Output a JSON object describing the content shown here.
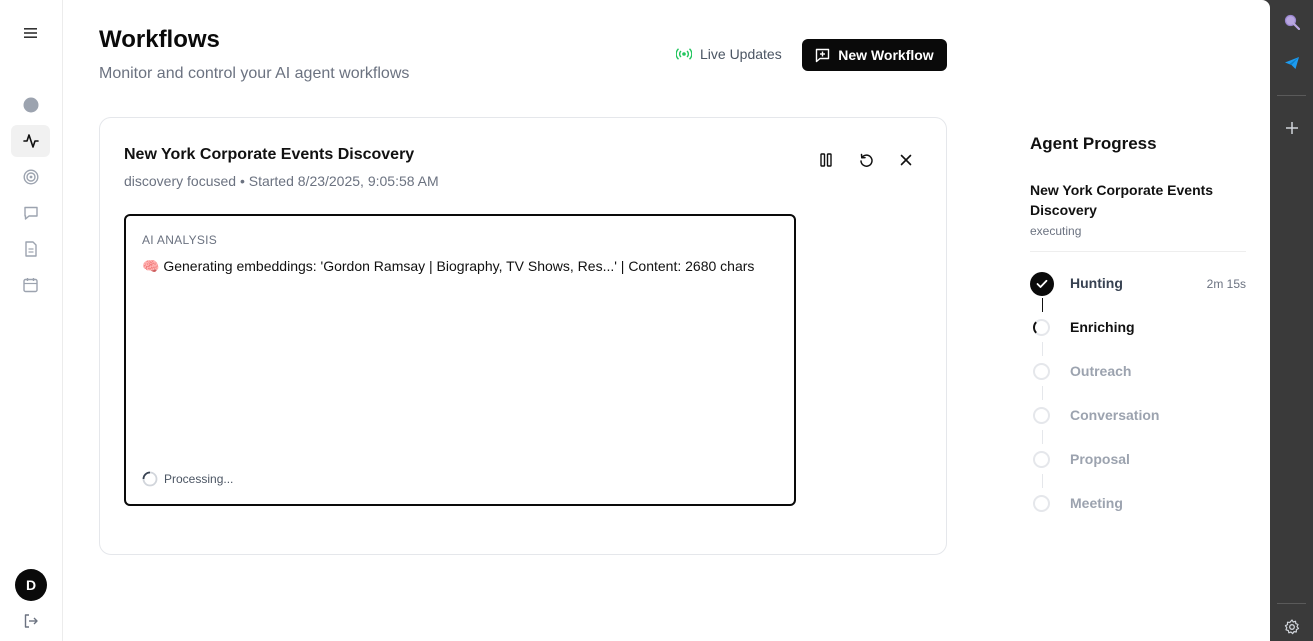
{
  "header": {
    "title": "Workflows",
    "subtitle": "Monitor and control your AI agent workflows",
    "live_updates_label": "Live Updates",
    "new_workflow_label": "New Workflow",
    "live_color": "#22c55e"
  },
  "sidebar": {
    "items": [
      {
        "icon": "circle-icon"
      },
      {
        "icon": "activity-icon",
        "active": true
      },
      {
        "icon": "target-icon"
      },
      {
        "icon": "message-icon"
      },
      {
        "icon": "document-icon"
      },
      {
        "icon": "calendar-icon"
      }
    ],
    "avatar_initial": "D"
  },
  "workflow": {
    "title": "New York Corporate Events Discovery",
    "meta": "discovery focused • Started 8/23/2025, 9:05:58 AM",
    "analysis_label": "AI ANALYSIS",
    "analysis_emoji": "🧠",
    "analysis_text": "Generating embeddings: 'Gordon Ramsay | Biography, TV Shows, Res...' | Content: 2680 chars",
    "processing_label": "Processing..."
  },
  "progress": {
    "title": "Agent Progress",
    "workflow_name": "New York Corporate Events Discovery",
    "status": "executing",
    "steps": [
      {
        "label": "Hunting",
        "state": "done",
        "time": "2m 15s"
      },
      {
        "label": "Enriching",
        "state": "running",
        "time": ""
      },
      {
        "label": "Outreach",
        "state": "pending",
        "time": ""
      },
      {
        "label": "Conversation",
        "state": "pending",
        "time": ""
      },
      {
        "label": "Proposal",
        "state": "pending",
        "time": ""
      },
      {
        "label": "Meeting",
        "state": "pending",
        "time": ""
      }
    ]
  },
  "rail": {
    "items": [
      "search-icon",
      "send-icon",
      "plus-icon",
      "settings-icon"
    ],
    "accent": "#1d9bf0"
  }
}
